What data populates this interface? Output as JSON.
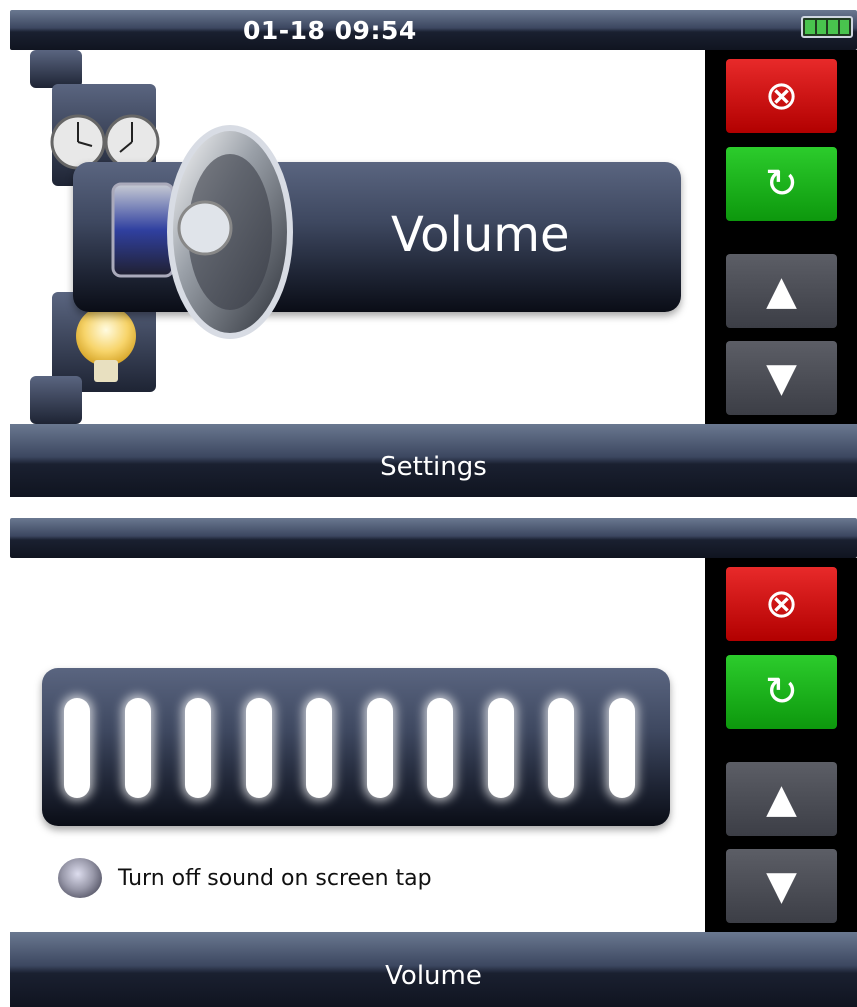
{
  "screen1": {
    "status": {
      "datetime": "01-18 09:54"
    },
    "main_tile": {
      "label": "Volume",
      "icon": "speaker-icon"
    },
    "background_tiles": [
      "clock-icon",
      "lightbulb-icon"
    ],
    "footer_title": "Settings",
    "side_buttons": [
      {
        "name": "close-button",
        "glyph": "⊗",
        "color": "#d81414"
      },
      {
        "name": "back-button",
        "glyph": "↻",
        "color": "#1aad1a"
      },
      {
        "name": "up-button",
        "glyph": "▲",
        "color": "#4a4c54"
      },
      {
        "name": "down-button",
        "glyph": "▼",
        "color": "#4a4c54"
      }
    ]
  },
  "screen2": {
    "volume_level": 10,
    "volume_max": 10,
    "toggle_label": "Turn off sound on screen tap",
    "footer_title": "Volume",
    "side_buttons": [
      {
        "name": "close-button",
        "glyph": "⊗",
        "color": "#d81414"
      },
      {
        "name": "back-button",
        "glyph": "↻",
        "color": "#1aad1a"
      },
      {
        "name": "up-button",
        "glyph": "▲",
        "color": "#4a4c54"
      },
      {
        "name": "down-button",
        "glyph": "▼",
        "color": "#4a4c54"
      }
    ]
  }
}
